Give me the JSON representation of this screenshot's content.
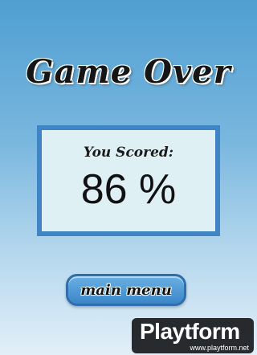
{
  "title": "Game Over",
  "score": {
    "label": "You Scored:",
    "value": "86 %"
  },
  "menu_button": {
    "label": "main menu"
  },
  "watermark": {
    "logo": "Playtform",
    "url": "www.playtform.net"
  }
}
